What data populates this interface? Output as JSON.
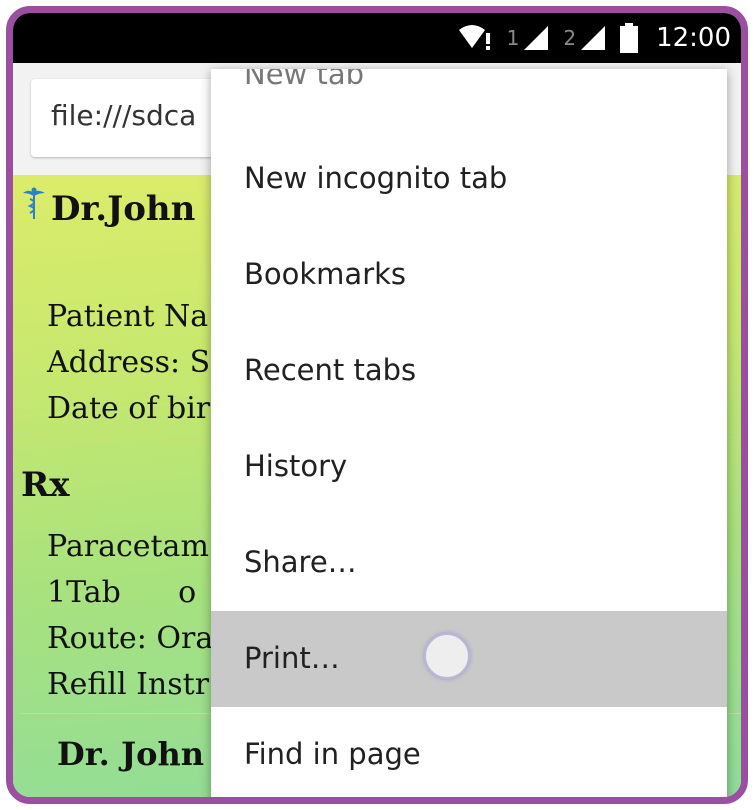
{
  "status_bar": {
    "sim1_label": "1",
    "sim2_label": "2",
    "time": "12:00",
    "icons": [
      "wifi-alert-icon",
      "signal-icon",
      "battery-icon"
    ]
  },
  "browser": {
    "url": "file:///sdca"
  },
  "page": {
    "title": "Dr.John",
    "patient_name": "Patient Na",
    "address": "Address: S",
    "dob": "Date of bir",
    "rx_heading": "Rx",
    "med_name": "Paracetam",
    "dose_line": "1Tab      o",
    "route": "Route: Ora",
    "refill": "Refill Instr",
    "footer_name": "Dr. John I"
  },
  "menu": {
    "items": [
      {
        "label": "New tab"
      },
      {
        "label": "New incognito tab"
      },
      {
        "label": "Bookmarks"
      },
      {
        "label": "Recent tabs"
      },
      {
        "label": "History"
      },
      {
        "label": "Share…"
      },
      {
        "label": "Print…"
      },
      {
        "label": "Find in page"
      }
    ],
    "pressed_item": "Print…"
  },
  "colors": {
    "frame": "#9b4fa0",
    "page_gradient_top": "#dcec6a",
    "page_gradient_bottom": "#8fdc9a",
    "menu_pressed": "#c9c9c9"
  }
}
